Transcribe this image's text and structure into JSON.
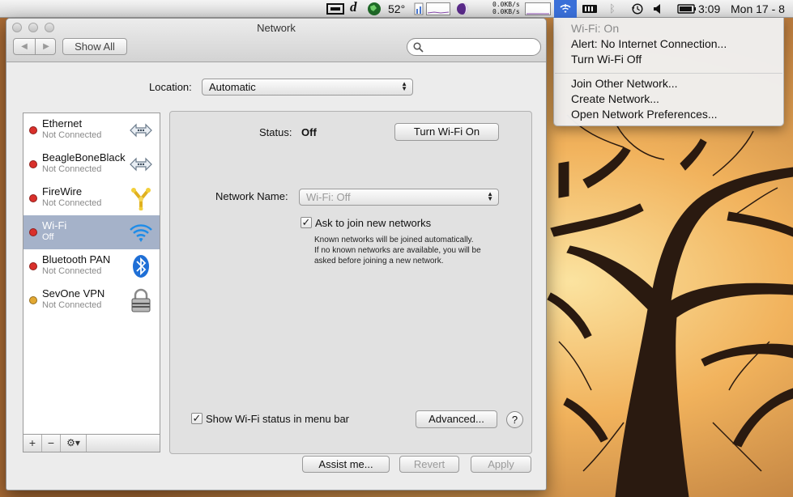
{
  "menubar": {
    "temperature": "52°",
    "net_up": "0.0KB/s",
    "net_down": "0.0KB/s",
    "time": "3:09",
    "date": "Mon 17 - 8",
    "icons": [
      "display-icon",
      "dictionary-icon",
      "globe-icon",
      "cpu-graph-icon",
      "moon-phase-icon",
      "wifi-icon",
      "battery-meter-icon",
      "bluetooth-icon",
      "time-machine-icon",
      "volume-icon",
      "battery-icon"
    ]
  },
  "wifi_menu": {
    "status": "Wi-Fi: On",
    "alert": "Alert: No Internet Connection...",
    "turn_off": "Turn Wi-Fi Off",
    "join_other": "Join Other Network...",
    "create": "Create Network...",
    "open_prefs": "Open Network Preferences..."
  },
  "window": {
    "title": "Network",
    "show_all": "Show All",
    "location_label": "Location:",
    "location_value": "Automatic"
  },
  "services": [
    {
      "name": "Ethernet",
      "status": "Not Connected",
      "dot": "#d9302b",
      "icon": "ethernet-icon"
    },
    {
      "name": "BeagleBoneBlack",
      "status": "Not Connected",
      "dot": "#d9302b",
      "icon": "ethernet-icon"
    },
    {
      "name": "FireWire",
      "status": "Not Connected",
      "dot": "#d9302b",
      "icon": "firewire-icon"
    },
    {
      "name": "Wi-Fi",
      "status": "Off",
      "dot": "#d9302b",
      "icon": "wifi-icon"
    },
    {
      "name": "Bluetooth PAN",
      "status": "Not Connected",
      "dot": "#d9302b",
      "icon": "bluetooth-icon"
    },
    {
      "name": "SevOne VPN",
      "status": "Not Connected",
      "dot": "#e2a832",
      "icon": "lock-icon"
    }
  ],
  "selected_service": "Wi-Fi",
  "list_buttons": {
    "add": "+",
    "remove": "−",
    "gear": "⚙▾"
  },
  "detail": {
    "status_label": "Status:",
    "status_value": "Off",
    "turn_on": "Turn Wi-Fi On",
    "network_name_label": "Network Name:",
    "network_name_value": "Wi-Fi: Off",
    "ask_label": "Ask to join new networks",
    "ask_checked": true,
    "note_1": "Known networks will be joined automatically.",
    "note_2": "If no known networks are available, you will be",
    "note_3": "asked before joining a new network.",
    "show_status_label": "Show Wi-Fi status in menu bar",
    "show_status_checked": true,
    "advanced": "Advanced...",
    "help": "?"
  },
  "footer": {
    "assist": "Assist me...",
    "revert": "Revert",
    "apply": "Apply"
  },
  "colors": {
    "selection": "#a5b2c9",
    "menu_highlight": "#3a6fd8",
    "error_dot": "#d9302b",
    "warning_dot": "#e2a832"
  }
}
